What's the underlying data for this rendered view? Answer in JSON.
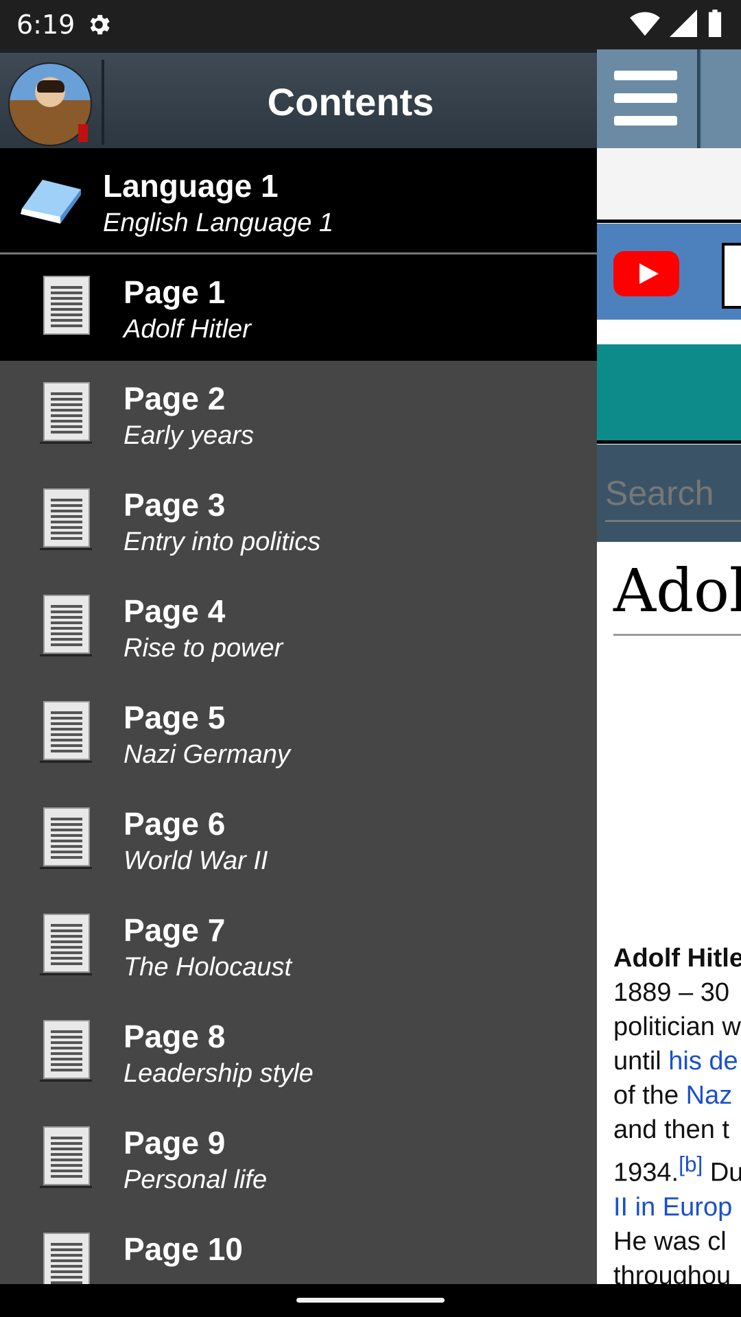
{
  "status_bar": {
    "time": "6:19",
    "icons": [
      "settings-gear-icon",
      "wifi-icon",
      "signal-icon",
      "battery-icon"
    ]
  },
  "drawer": {
    "title": "Contents",
    "language": {
      "title": "Language 1",
      "subtitle": "English Language 1"
    },
    "pages": [
      {
        "title": "Page 1",
        "subtitle": "Adolf Hitler",
        "active": true
      },
      {
        "title": "Page 2",
        "subtitle": "Early years"
      },
      {
        "title": "Page 3",
        "subtitle": "Entry into politics"
      },
      {
        "title": "Page 4",
        "subtitle": "Rise to power"
      },
      {
        "title": "Page 5",
        "subtitle": "Nazi Germany"
      },
      {
        "title": "Page 6",
        "subtitle": "World War II"
      },
      {
        "title": "Page 7",
        "subtitle": "The Holocaust"
      },
      {
        "title": "Page 8",
        "subtitle": "Leadership style"
      },
      {
        "title": "Page 9",
        "subtitle": "Personal life"
      },
      {
        "title": "Page 10",
        "subtitle": ""
      }
    ]
  },
  "background_app": {
    "search_placeholder": "Search",
    "article_title": "Adol",
    "article_lines": [
      {
        "text": "Adolf Hitle",
        "bold": true
      },
      {
        "text": "1889 – 30"
      },
      {
        "text": "politician w"
      },
      {
        "text": "until ",
        "link": "his de"
      },
      {
        "text": "of the ",
        "link": "Naz"
      },
      {
        "text": "and then t"
      },
      {
        "text": "1934.",
        "sup": "[b]",
        "after": " Du"
      },
      {
        "link_only": "II in Europ"
      },
      {
        "text": "He was cl"
      },
      {
        "text": "throughou"
      }
    ]
  }
}
